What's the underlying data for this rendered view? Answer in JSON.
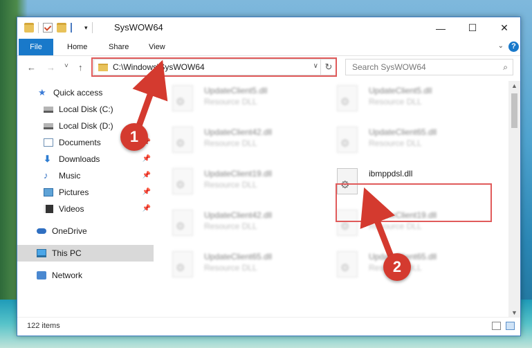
{
  "window": {
    "title": "SysWOW64",
    "controls": {
      "minimize": "—",
      "maximize": "☐",
      "close": "✕"
    }
  },
  "ribbon": {
    "tabs": [
      "File",
      "Home",
      "Share",
      "View"
    ],
    "help": "?"
  },
  "navigation": {
    "back": "←",
    "forward": "→",
    "recent": "˅",
    "up": "↑",
    "address": "C:\\Windows\\SysWOW64",
    "search_placeholder": "Search SysWOW64"
  },
  "nav_pane": {
    "items": [
      {
        "label": "Quick access",
        "icon": "star-icon",
        "pinned": false
      },
      {
        "label": "Local Disk (C:)",
        "icon": "disk-icon",
        "pinned": false
      },
      {
        "label": "Local Disk (D:)",
        "icon": "disk-icon",
        "pinned": false
      },
      {
        "label": "Documents",
        "icon": "documents-icon",
        "pinned": true
      },
      {
        "label": "Downloads",
        "icon": "download-icon",
        "pinned": true
      },
      {
        "label": "Music",
        "icon": "music-icon",
        "pinned": true
      },
      {
        "label": "Pictures",
        "icon": "pictures-icon",
        "pinned": true
      },
      {
        "label": "Videos",
        "icon": "videos-icon",
        "pinned": true
      },
      {
        "label": "OneDrive",
        "icon": "cloud-icon",
        "pinned": false
      },
      {
        "label": "This PC",
        "icon": "computer-icon",
        "pinned": false,
        "selected": true
      },
      {
        "label": "Network",
        "icon": "network-icon",
        "pinned": false
      }
    ]
  },
  "files": {
    "left_column": [
      {
        "name": "UpdateClient5.dll",
        "type": "Resource DLL"
      },
      {
        "name": "UpdateClient42.dll",
        "type": "Resource DLL"
      },
      {
        "name": "UpdateClient19.dll",
        "type": "Resource DLL"
      },
      {
        "name": "UpdateClient42.dll",
        "type": "Resource DLL"
      },
      {
        "name": "UpdateClient65.dll",
        "type": "Resource DLL"
      }
    ],
    "right_column": [
      {
        "name": "UpdateClient5.dll",
        "type": "Resource DLL"
      },
      {
        "name": "UpdateClient65.dll",
        "type": "Resource DLL"
      },
      {
        "name": "ibmppdsl.dll",
        "type": ""
      },
      {
        "name": "UpdateClient19.dll",
        "type": "Resource DLL"
      },
      {
        "name": "UpdateClient65.dll",
        "type": "Resource DLL"
      }
    ],
    "highlighted": "ibmppdsl.dll"
  },
  "status": {
    "count": "122 items"
  },
  "annotations": {
    "step1": "1",
    "step2": "2",
    "color": "#d43a2f"
  }
}
